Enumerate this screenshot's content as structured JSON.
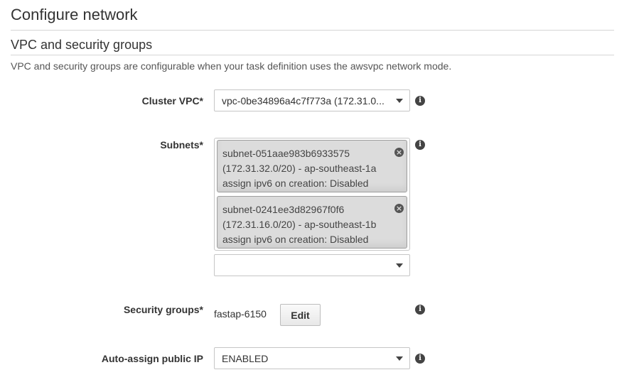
{
  "page": {
    "title": "Configure network"
  },
  "section": {
    "title": "VPC and security groups",
    "description": "VPC and security groups are configurable when your task definition uses the awsvpc network mode."
  },
  "fields": {
    "cluster_vpc": {
      "label": "Cluster VPC*",
      "value": "vpc-0be34896a4c7f773a (172.31.0..."
    },
    "subnets": {
      "label": "Subnets*",
      "selected": [
        {
          "id": "subnet-051aae983b6933575",
          "cidr_az": "(172.31.32.0/20) - ap-southeast-1a",
          "ipv6": "assign ipv6 on creation: Disabled"
        },
        {
          "id": "subnet-0241ee3d82967f0f6",
          "cidr_az": "(172.31.16.0/20) - ap-southeast-1b",
          "ipv6": "assign ipv6 on creation: Disabled"
        }
      ],
      "add_value": ""
    },
    "security_groups": {
      "label": "Security groups*",
      "value": "fastap-6150",
      "edit_label": "Edit"
    },
    "auto_assign_ip": {
      "label": "Auto-assign public IP",
      "value": "ENABLED"
    }
  },
  "icons": {
    "info": "info-icon",
    "remove": "close-circle-icon",
    "dropdown": "chevron-down-icon"
  }
}
